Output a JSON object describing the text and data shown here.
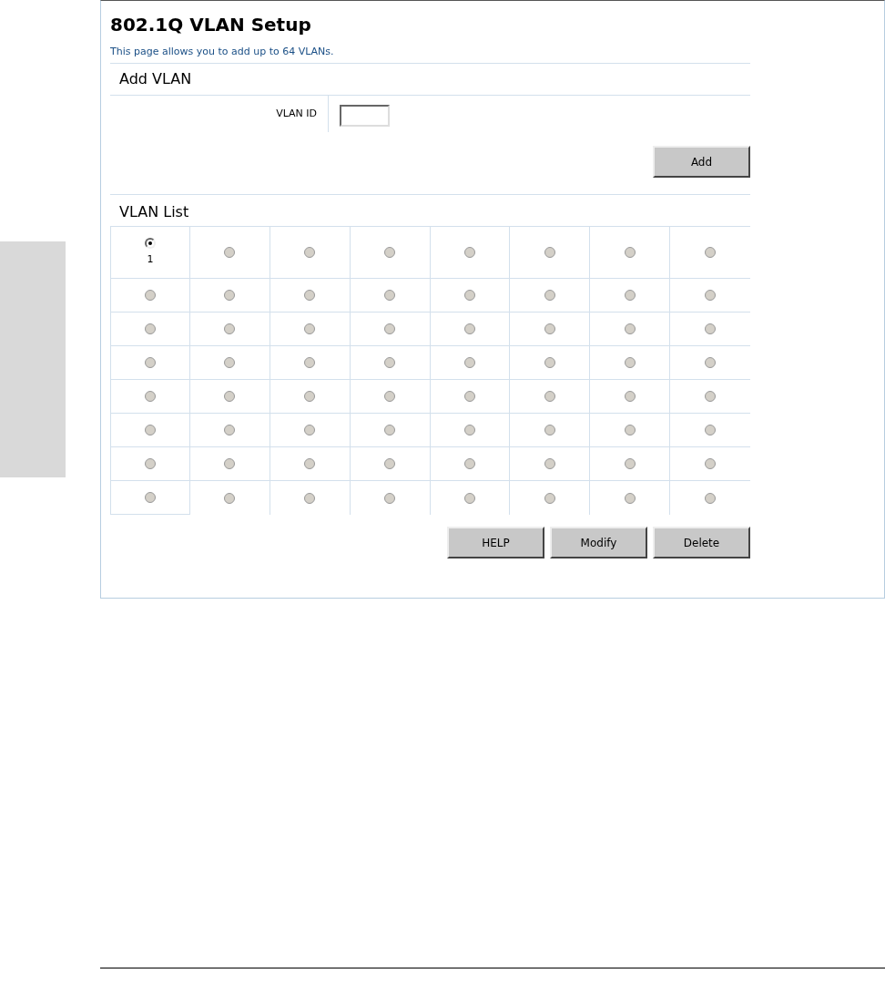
{
  "title": "802.1Q VLAN Setup",
  "description": "This page allows you to add up to 64 VLANs.",
  "add_vlan": {
    "heading": "Add VLAN",
    "field_label": "VLAN ID",
    "button": "Add"
  },
  "vlan_list": {
    "heading": "VLAN List",
    "slots": [
      {
        "label": "1",
        "selected": true,
        "disabled": false
      },
      {
        "selected": false,
        "disabled": true
      },
      {
        "selected": false,
        "disabled": true
      },
      {
        "selected": false,
        "disabled": true
      },
      {
        "selected": false,
        "disabled": true
      },
      {
        "selected": false,
        "disabled": true
      },
      {
        "selected": false,
        "disabled": true
      },
      {
        "selected": false,
        "disabled": true
      },
      {
        "selected": false,
        "disabled": true
      },
      {
        "selected": false,
        "disabled": true
      },
      {
        "selected": false,
        "disabled": true
      },
      {
        "selected": false,
        "disabled": true
      },
      {
        "selected": false,
        "disabled": true
      },
      {
        "selected": false,
        "disabled": true
      },
      {
        "selected": false,
        "disabled": true
      },
      {
        "selected": false,
        "disabled": true
      },
      {
        "selected": false,
        "disabled": true
      },
      {
        "selected": false,
        "disabled": true
      },
      {
        "selected": false,
        "disabled": true
      },
      {
        "selected": false,
        "disabled": true
      },
      {
        "selected": false,
        "disabled": true
      },
      {
        "selected": false,
        "disabled": true
      },
      {
        "selected": false,
        "disabled": true
      },
      {
        "selected": false,
        "disabled": true
      },
      {
        "selected": false,
        "disabled": true
      },
      {
        "selected": false,
        "disabled": true
      },
      {
        "selected": false,
        "disabled": true
      },
      {
        "selected": false,
        "disabled": true
      },
      {
        "selected": false,
        "disabled": true
      },
      {
        "selected": false,
        "disabled": true
      },
      {
        "selected": false,
        "disabled": true
      },
      {
        "selected": false,
        "disabled": true
      },
      {
        "selected": false,
        "disabled": true
      },
      {
        "selected": false,
        "disabled": true
      },
      {
        "selected": false,
        "disabled": true
      },
      {
        "selected": false,
        "disabled": true
      },
      {
        "selected": false,
        "disabled": true
      },
      {
        "selected": false,
        "disabled": true
      },
      {
        "selected": false,
        "disabled": true
      },
      {
        "selected": false,
        "disabled": true
      },
      {
        "selected": false,
        "disabled": true
      },
      {
        "selected": false,
        "disabled": true
      },
      {
        "selected": false,
        "disabled": true
      },
      {
        "selected": false,
        "disabled": true
      },
      {
        "selected": false,
        "disabled": true
      },
      {
        "selected": false,
        "disabled": true
      },
      {
        "selected": false,
        "disabled": true
      },
      {
        "selected": false,
        "disabled": true
      },
      {
        "selected": false,
        "disabled": true
      },
      {
        "selected": false,
        "disabled": true
      },
      {
        "selected": false,
        "disabled": true
      },
      {
        "selected": false,
        "disabled": true
      },
      {
        "selected": false,
        "disabled": true
      },
      {
        "selected": false,
        "disabled": true
      },
      {
        "selected": false,
        "disabled": true
      },
      {
        "selected": false,
        "disabled": true
      },
      {
        "selected": false,
        "disabled": true
      },
      {
        "selected": false,
        "disabled": true
      },
      {
        "selected": false,
        "disabled": true
      },
      {
        "selected": false,
        "disabled": true
      },
      {
        "selected": false,
        "disabled": true
      },
      {
        "selected": false,
        "disabled": true
      },
      {
        "selected": false,
        "disabled": true
      },
      {
        "selected": false,
        "disabled": true
      }
    ]
  },
  "buttons": [
    "HELP",
    "Modify",
    "Delete"
  ]
}
